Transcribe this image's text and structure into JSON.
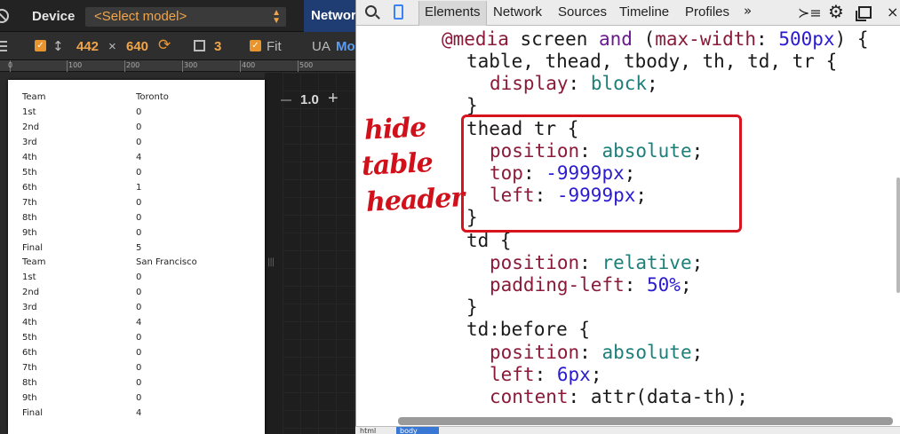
{
  "device_toolbar": {
    "device_label": "Device",
    "model_select": "<Select model>",
    "network_tab": "Network",
    "width": "442",
    "times": "×",
    "height": "640",
    "scale": "3",
    "fit_label": "Fit",
    "ua_label": "UA",
    "ua_value": "Mo"
  },
  "ruler": {
    "ticks": [
      "0",
      "100",
      "200",
      "300",
      "400",
      "500"
    ]
  },
  "zoom": {
    "value": "1.0",
    "plus": "+"
  },
  "table": {
    "rows": [
      {
        "c1": "Team",
        "c2": "Toronto"
      },
      {
        "c1": "1st",
        "c2": "0"
      },
      {
        "c1": "2nd",
        "c2": "0"
      },
      {
        "c1": "3rd",
        "c2": "0"
      },
      {
        "c1": "4th",
        "c2": "4"
      },
      {
        "c1": "5th",
        "c2": "0"
      },
      {
        "c1": "6th",
        "c2": "1"
      },
      {
        "c1": "7th",
        "c2": "0"
      },
      {
        "c1": "8th",
        "c2": "0"
      },
      {
        "c1": "9th",
        "c2": "0"
      },
      {
        "c1": "Final",
        "c2": "5"
      },
      {
        "c1": "Team",
        "c2": "San Francisco"
      },
      {
        "c1": "1st",
        "c2": "0"
      },
      {
        "c1": "2nd",
        "c2": "0"
      },
      {
        "c1": "3rd",
        "c2": "0"
      },
      {
        "c1": "4th",
        "c2": "4"
      },
      {
        "c1": "5th",
        "c2": "0"
      },
      {
        "c1": "6th",
        "c2": "0"
      },
      {
        "c1": "7th",
        "c2": "0"
      },
      {
        "c1": "8th",
        "c2": "0"
      },
      {
        "c1": "9th",
        "c2": "0"
      },
      {
        "c1": "Final",
        "c2": "4"
      }
    ]
  },
  "devtools": {
    "tabs": [
      "Elements",
      "Network",
      "Sources",
      "Timeline",
      "Profiles"
    ],
    "more": "»",
    "close": "×"
  },
  "code": {
    "l1_at": "@media",
    "l1_rest": " screen ",
    "l1_and": "and",
    "l1_paren": " (",
    "l1_prop": "max-width",
    "l1_colon": ": ",
    "l1_num": "500px",
    "l1_end": ") {",
    "l2": "table, thead, tbody, th, td, tr {",
    "l3_prop": "display",
    "l3_val": "block",
    "l4": "}",
    "l5": "thead tr {",
    "l6_prop": "position",
    "l6_val": "absolute",
    "l7_prop": "top",
    "l7_val": "-9999px",
    "l8_prop": "left",
    "l8_val": "-9999px",
    "l9": "}",
    "l10": "td {",
    "l11_prop": "position",
    "l11_val": "relative",
    "l12_prop": "padding-left",
    "l12_val": "50%",
    "l13": "}",
    "l14": "td:before {",
    "l15_prop": "position",
    "l15_val": "absolute",
    "l16_prop": "left",
    "l16_val": "6px",
    "l17_prop": "content",
    "l17_val": "attr(data-th)"
  },
  "annotation": {
    "word1": "hide",
    "word2": "table",
    "word3": "header"
  },
  "breadcrumbs": {
    "html": "html",
    "body": "body"
  },
  "colors": {
    "accent_orange": "#e8952f",
    "annotation_red": "#d7141d",
    "devtools_blue": "#3b82f5"
  }
}
